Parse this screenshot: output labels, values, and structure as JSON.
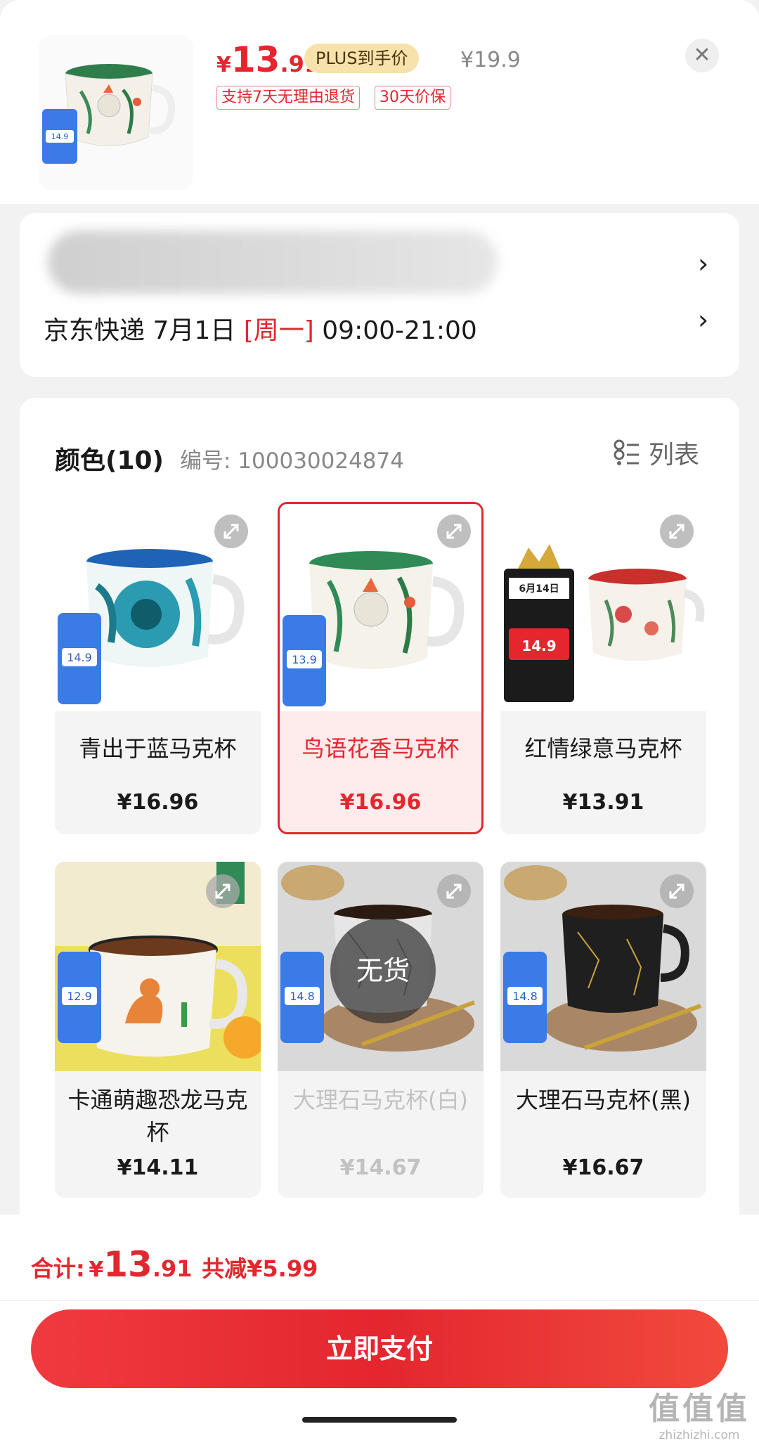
{
  "header": {
    "price": {
      "currency": "¥",
      "integer": "13",
      "decimal": ".91"
    },
    "plus_badge": "PLUS到手价",
    "original_price": "¥19.9",
    "tags": [
      "支持7天无理由退货",
      "30天价保"
    ],
    "close_icon": "close-icon"
  },
  "address": {
    "delivery_carrier": "京东快递",
    "delivery_date": "7月1日",
    "delivery_weekday": "[周一]",
    "delivery_time": "09:00-21:00"
  },
  "variants": {
    "title": "颜色(10)",
    "sku_label": "编号: 100030024874",
    "list_toggle_label": "列表",
    "items": [
      {
        "name": "青出于蓝马克杯",
        "price": "¥16.96",
        "state": "normal"
      },
      {
        "name": "鸟语花香马克杯",
        "price": "¥16.96",
        "state": "selected"
      },
      {
        "name": "红情绿意马克杯",
        "price": "¥13.91",
        "state": "normal"
      },
      {
        "name": "卡通萌趣恐龙马克杯",
        "price": "¥14.11",
        "state": "normal"
      },
      {
        "name": "大理石马克杯(白)",
        "price": "¥14.67",
        "state": "out_of_stock"
      },
      {
        "name": "大理石马克杯(黑)",
        "price": "¥16.67",
        "state": "normal"
      }
    ],
    "out_of_stock_label": "无货",
    "promo_prices": [
      "14.9",
      "14.9",
      "13.9",
      "12.9",
      "14.8",
      "14.8",
      "14.9"
    ],
    "promo_date": "6月14日"
  },
  "footer": {
    "total_label": "合计:",
    "total": {
      "currency": "¥",
      "integer": "13",
      "decimal": ".91"
    },
    "saving": "共减¥5.99",
    "pay_button": "立即支付"
  },
  "watermark": {
    "mark": "值值值",
    "domain": "zhizhizhi.com"
  },
  "colors": {
    "accent": "#e4262f",
    "plus_badge_bg": "#f6e2aa",
    "page_bg": "#f2f2f2"
  }
}
